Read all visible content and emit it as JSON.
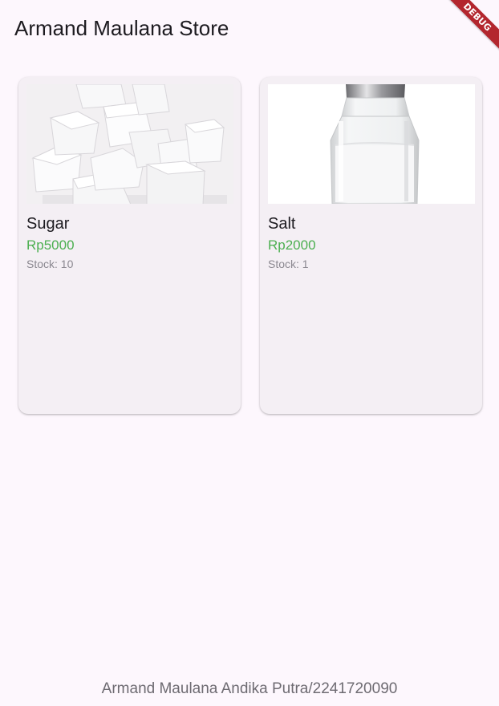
{
  "app_bar": {
    "title": "Armand Maulana Store"
  },
  "debug_banner": {
    "label": "DEBUG",
    "color": "#b3262e"
  },
  "products": [
    {
      "name": "Sugar",
      "price": "Rp5000",
      "stock": "Stock: 10",
      "image_icon": "sugar-cubes-image"
    },
    {
      "name": "Salt",
      "price": "Rp2000",
      "stock": "Stock: 1",
      "image_icon": "salt-shaker-image"
    }
  ],
  "footer": {
    "text": "Armand Maulana Andika Putra/2241720090"
  },
  "colors": {
    "background": "#fdf7fd",
    "card": "#f4eff4",
    "price": "#4caf50",
    "secondary_text": "#8b8890"
  }
}
